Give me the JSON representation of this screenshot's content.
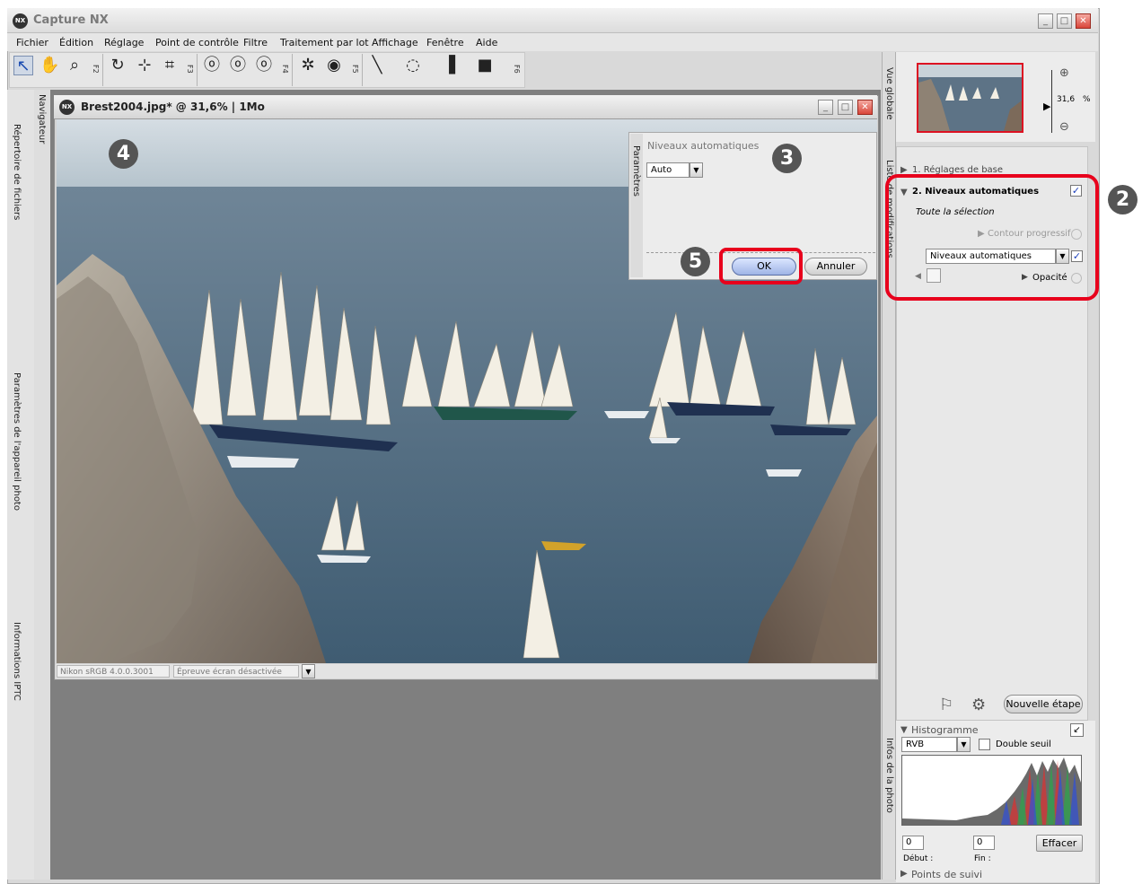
{
  "app": {
    "title": "Capture NX"
  },
  "menu": [
    "Fichier",
    "Édition",
    "Réglage",
    "Point de contrôle",
    "Filtre",
    "Traitement par lot",
    "Affichage",
    "Fenêtre",
    "Aide"
  ],
  "toolbar": {
    "fkeys": [
      "F2",
      "F3",
      "F4",
      "F5",
      "F6"
    ]
  },
  "left_tabs": [
    "Répertoire de fichiers",
    "Paramètres de l'appareil photo",
    "Informations IPTC"
  ],
  "navigator_tab": "Navigateur",
  "image_window": {
    "title": "Brest2004.jpg* @ 31,6% | 1Mo",
    "status_profile": "Nikon sRGB 4.0.0.3001",
    "status_proof": "Épreuve écran désactivée"
  },
  "params_panel": {
    "tab": "Paramètres",
    "title": "Niveaux automatiques",
    "mode_value": "Auto",
    "ok_label": "OK",
    "cancel_label": "Annuler"
  },
  "overview": {
    "tab": "Vue globale",
    "zoom_value": "31,6",
    "zoom_unit": "%"
  },
  "edit_list": {
    "tab": "Liste de modifications",
    "step1": "1. Réglages de base",
    "step2": "2. Niveaux automatiques",
    "selection": "Toute la sélection",
    "feather": "Contour progressif",
    "enhancement": "Niveaux automatiques",
    "opacity": "Opacité",
    "new_step": "Nouvelle étape"
  },
  "photo_info": {
    "tab": "Infos de la photo",
    "histogram_title": "Histogramme",
    "channel": "RVB",
    "double_threshold": "Double seuil",
    "start_value": "0",
    "end_value": "0",
    "start_label": "Début :",
    "end_label": "Fin :",
    "clear_label": "Effacer",
    "tracking": "Points de suivi"
  },
  "callouts": [
    "2",
    "3",
    "4",
    "5"
  ],
  "colors": {
    "highlight_red": "#e8001c",
    "callout_gray": "#555555",
    "workspace_gray": "#7f7f7f",
    "sea_blue": "#3f5c72"
  }
}
